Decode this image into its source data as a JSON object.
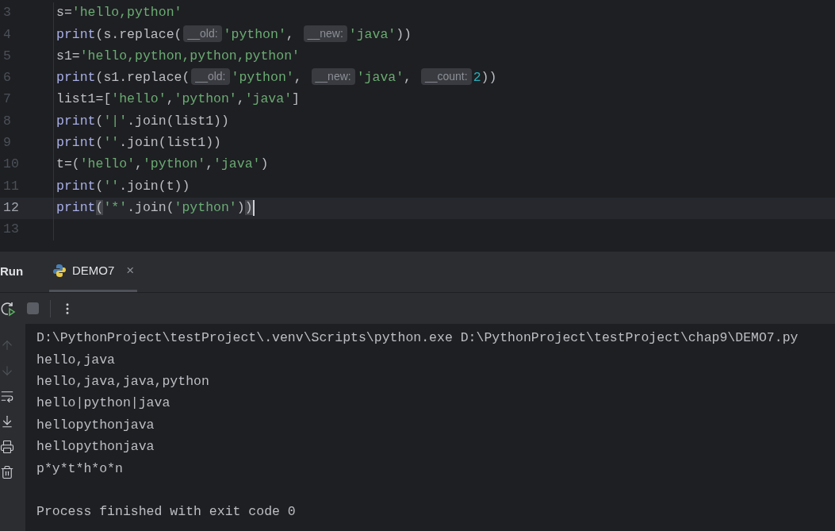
{
  "editor": {
    "lines": [
      {
        "number": "3",
        "current": false,
        "caret": false,
        "tokens": [
          {
            "kind": "plain",
            "text": "s="
          },
          {
            "kind": "str",
            "text": "'hello,python'"
          }
        ]
      },
      {
        "number": "4",
        "current": false,
        "caret": false,
        "tokens": [
          {
            "kind": "fn",
            "text": "print"
          },
          {
            "kind": "plain",
            "text": "(s.replace("
          },
          {
            "kind": "hint",
            "text": "__old:"
          },
          {
            "kind": "str",
            "text": "'python'"
          },
          {
            "kind": "plain",
            "text": ", "
          },
          {
            "kind": "hint",
            "text": "__new:"
          },
          {
            "kind": "str",
            "text": "'java'"
          },
          {
            "kind": "plain",
            "text": "))"
          }
        ]
      },
      {
        "number": "5",
        "current": false,
        "caret": false,
        "tokens": [
          {
            "kind": "plain",
            "text": "s1="
          },
          {
            "kind": "str",
            "text": "'hello,python,python,python'"
          }
        ]
      },
      {
        "number": "6",
        "current": false,
        "caret": false,
        "tokens": [
          {
            "kind": "fn",
            "text": "print"
          },
          {
            "kind": "plain",
            "text": "(s1.replace("
          },
          {
            "kind": "hint",
            "text": "__old:"
          },
          {
            "kind": "str",
            "text": "'python'"
          },
          {
            "kind": "plain",
            "text": ", "
          },
          {
            "kind": "hint",
            "text": "__new:"
          },
          {
            "kind": "str",
            "text": "'java'"
          },
          {
            "kind": "plain",
            "text": ", "
          },
          {
            "kind": "hint",
            "text": "__count:"
          },
          {
            "kind": "num",
            "text": "2"
          },
          {
            "kind": "plain",
            "text": "))"
          }
        ]
      },
      {
        "number": "7",
        "current": false,
        "caret": false,
        "tokens": [
          {
            "kind": "plain",
            "text": "list1=["
          },
          {
            "kind": "str",
            "text": "'hello'"
          },
          {
            "kind": "plain",
            "text": ","
          },
          {
            "kind": "str",
            "text": "'python'"
          },
          {
            "kind": "plain",
            "text": ","
          },
          {
            "kind": "str",
            "text": "'java'"
          },
          {
            "kind": "plain",
            "text": "]"
          }
        ]
      },
      {
        "number": "8",
        "current": false,
        "caret": false,
        "tokens": [
          {
            "kind": "fn",
            "text": "print"
          },
          {
            "kind": "plain",
            "text": "("
          },
          {
            "kind": "str",
            "text": "'|'"
          },
          {
            "kind": "plain",
            "text": ".join(list1))"
          }
        ]
      },
      {
        "number": "9",
        "current": false,
        "caret": false,
        "tokens": [
          {
            "kind": "fn",
            "text": "print"
          },
          {
            "kind": "plain",
            "text": "("
          },
          {
            "kind": "str",
            "text": "''"
          },
          {
            "kind": "plain",
            "text": ".join(list1))"
          }
        ]
      },
      {
        "number": "10",
        "current": false,
        "caret": false,
        "tokens": [
          {
            "kind": "plain",
            "text": "t=("
          },
          {
            "kind": "str",
            "text": "'hello'"
          },
          {
            "kind": "plain",
            "text": ","
          },
          {
            "kind": "str",
            "text": "'python'"
          },
          {
            "kind": "plain",
            "text": ","
          },
          {
            "kind": "str",
            "text": "'java'"
          },
          {
            "kind": "plain",
            "text": ")"
          }
        ]
      },
      {
        "number": "11",
        "current": false,
        "caret": false,
        "tokens": [
          {
            "kind": "fn",
            "text": "print"
          },
          {
            "kind": "plain",
            "text": "("
          },
          {
            "kind": "str",
            "text": "''"
          },
          {
            "kind": "plain",
            "text": ".join(t))"
          }
        ]
      },
      {
        "number": "12",
        "current": true,
        "caret": true,
        "tokens": [
          {
            "kind": "fn",
            "text": "print"
          },
          {
            "kind": "match",
            "text": "("
          },
          {
            "kind": "str",
            "text": "'*'"
          },
          {
            "kind": "plain",
            "text": ".join("
          },
          {
            "kind": "str",
            "text": "'python'"
          },
          {
            "kind": "plain",
            "text": ")"
          },
          {
            "kind": "match",
            "text": ")"
          }
        ]
      },
      {
        "number": "13",
        "current": false,
        "caret": false
      }
    ]
  },
  "run_panel": {
    "title": "Run",
    "tabs": [
      {
        "label": "DEMO7",
        "selected": true,
        "close": "×"
      }
    ],
    "toolbar": [
      {
        "kind": "rerun"
      },
      {
        "kind": "stop"
      },
      {
        "kind": "separator"
      },
      {
        "kind": "more"
      }
    ],
    "side_tools": [
      {
        "kind": "up",
        "disabled": true
      },
      {
        "kind": "down",
        "disabled": true
      },
      {
        "kind": "wrap",
        "disabled": false
      },
      {
        "kind": "scroll_end",
        "disabled": false
      },
      {
        "kind": "print",
        "disabled": false
      },
      {
        "kind": "delete",
        "disabled": false
      }
    ],
    "console": [
      "D:\\PythonProject\\testProject\\.venv\\Scripts\\python.exe D:\\PythonProject\\testProject\\chap9\\DEMO7.py",
      "hello,java",
      "hello,java,java,python",
      "hello|python|java",
      "hellopythonjava",
      "hellopythonjava",
      "p*y*t*h*o*n"
    ],
    "exit_message": "Process finished with exit code 0"
  }
}
